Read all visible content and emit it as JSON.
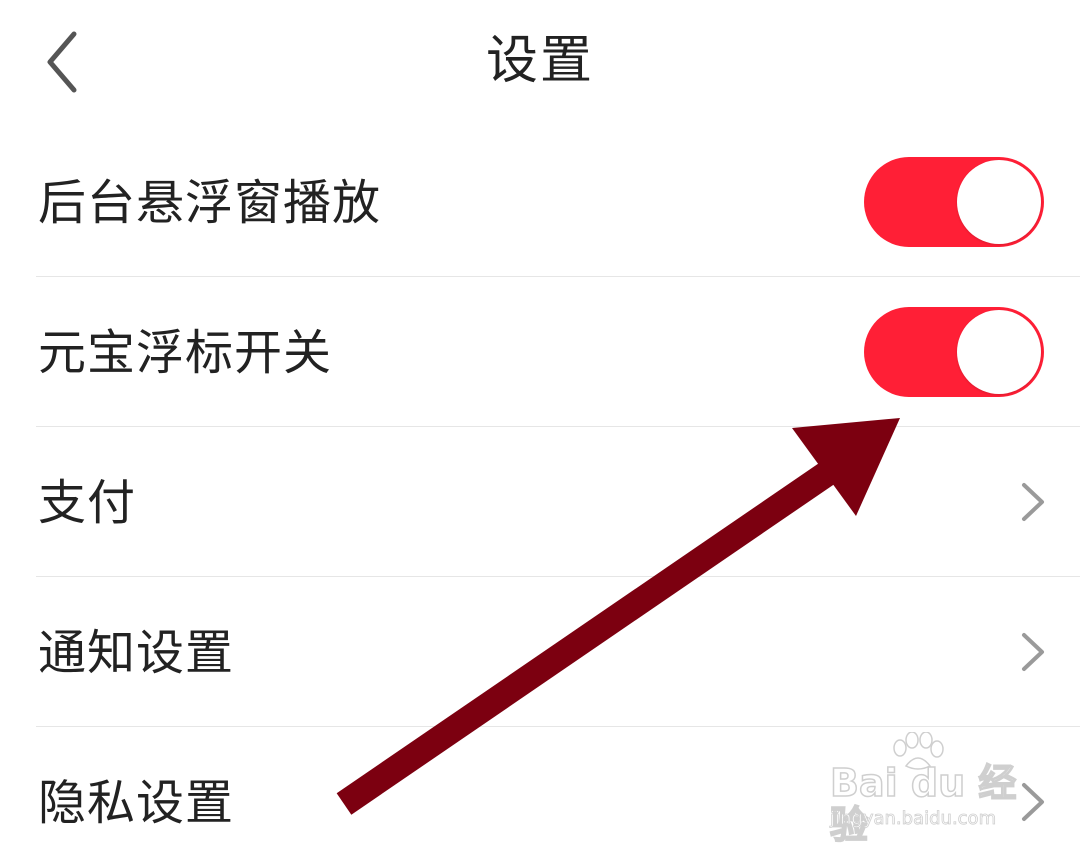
{
  "nav": {
    "title": "设置",
    "back_icon": "chevron-left-icon"
  },
  "settings": [
    {
      "label": "后台悬浮窗播放",
      "control": "toggle",
      "on": true
    },
    {
      "label": "元宝浮标开关",
      "control": "toggle",
      "on": true
    },
    {
      "label": "支付",
      "control": "chevron"
    },
    {
      "label": "通知设置",
      "control": "chevron"
    },
    {
      "label": "隐私设置",
      "control": "chevron"
    }
  ],
  "colors": {
    "toggle_on": "#ff1f36",
    "annotation_arrow": "#7c0010",
    "divider": "#e6e6e6",
    "chevron": "#9a9a9a"
  },
  "watermark": {
    "brand": "Bai du 经验",
    "url": "jingyan.baidu.com"
  }
}
